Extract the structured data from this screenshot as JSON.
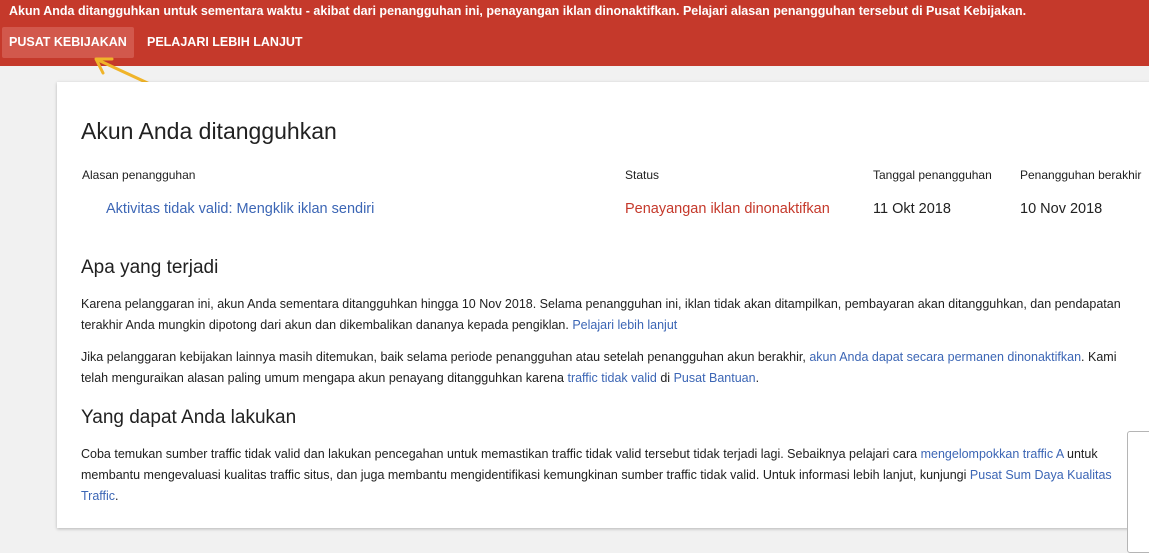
{
  "banner": {
    "message": "Akun Anda ditangguhkan untuk sementara waktu - akibat dari penangguhan ini, penayangan iklan dinonaktifkan. Pelajari alasan penangguhan tersebut di Pusat Kebijakan.",
    "policy_center_label": "PUSAT KEBIJAKAN",
    "learn_more_label": "PELAJARI LEBIH LANJUT",
    "bg_color": "#c5392b"
  },
  "card": {
    "title": "Akun Anda ditangguhkan",
    "table": {
      "headers": {
        "reason": "Alasan penangguhan",
        "status": "Status",
        "start": "Tanggal penangguhan",
        "end": "Penangguhan berakhir"
      },
      "row": {
        "reason": "Aktivitas tidak valid: Mengklik iklan sendiri",
        "status": "Penayangan iklan dinonaktifkan",
        "start": "11 Okt 2018",
        "end": "10 Nov 2018"
      }
    },
    "what_happened": {
      "title": "Apa yang terjadi",
      "p1_text": "Karena pelanggaran ini, akun Anda sementara ditangguhkan hingga 10 Nov 2018. Selama penangguhan ini, iklan tidak akan ditampilkan, pembayaran akan ditangguhkan, dan pendapatan terakhir Anda mungkin dipotong dari akun dan dikembalikan dananya kepada pengiklan.",
      "p1_link": "Pelajari lebih lanjut",
      "p2_text_a": "Jika pelanggaran kebijakan lainnya masih ditemukan, baik selama periode penangguhan atau setelah penangguhan akun berakhir,",
      "p2_link_a": "akun Anda dapat secara permanen dinonaktifkan",
      "p2_text_b": ". Kami telah menguraikan alasan paling umum mengapa akun penayang ditangguhkan karena",
      "p2_link_b": "traffic tidak valid",
      "p2_text_c": "di",
      "p2_link_c": "Pusat Bantuan",
      "p2_text_d": "."
    },
    "what_you_can_do": {
      "title": "Yang dapat Anda lakukan",
      "p_text_a": "Coba temukan sumber traffic tidak valid dan lakukan pencegahan untuk memastikan traffic tidak valid tersebut tidak terjadi lagi. Sebaiknya pelajari cara",
      "p_link_a": "mengelompokkan traffic A",
      "p_text_b": "untuk membantu mengevaluasi kualitas traffic situs, dan juga membantu mengidentifikasi kemungkinan sumber traffic tidak valid. Untuk informasi lebih lanjut, kunjungi",
      "p_link_b": "Pusat Sum Daya Kualitas Traffic",
      "p_text_c": "."
    }
  },
  "colors": {
    "link": "#3c66b5",
    "danger": "#c5392b",
    "annotation_arrow": "#f0b429"
  }
}
